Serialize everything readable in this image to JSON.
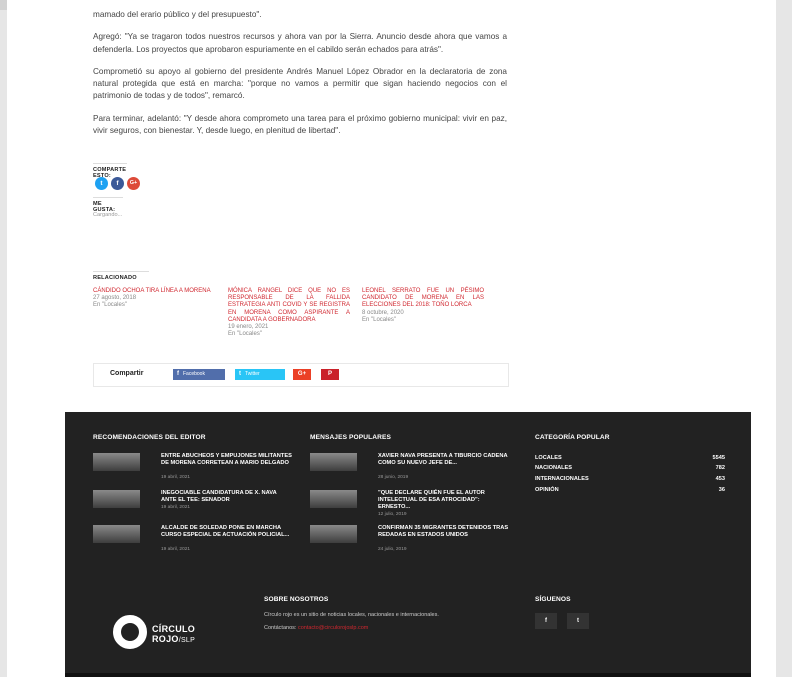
{
  "article": {
    "p0": "mamado del erario público y del presupuesto\".",
    "p1": "Agregó: \"Ya se tragaron todos nuestros recursos y ahora van por la Sierra. Anuncio desde ahora que vamos a defenderla. Los proyectos que aprobaron espuriamente en el cabildo serán echados para atrás\".",
    "p2": "Comprometió su apoyo al gobierno del presidente Andrés Manuel López Obrador en la declaratoria de zona natural protegida que está en marcha: \"porque no vamos a permitir que sigan haciendo negocios con el patrimonio de todas y de todos\", remarcó.",
    "p3": "Para terminar, adelantó: \"Y desde ahora comprometo una tarea para el próximo gobierno municipal: vivir en paz, vivir seguros, con bienestar. Y, desde luego, en plenitud de libertad\"."
  },
  "share": {
    "heading": "COMPARTE ESTO:",
    "twitter_icon": "t",
    "facebook_icon": "f",
    "google_icon": "G+",
    "colors": {
      "twitter": "#1da1f2",
      "facebook": "#3b5998",
      "google": "#dd4b39"
    }
  },
  "likes": {
    "heading": "ME GUSTA:",
    "loading": "Cargando..."
  },
  "related": {
    "heading": "RELACIONADO",
    "items": [
      {
        "title": "CÁNDIDO OCHOA TIRA LÍNEA A MORENA",
        "date": "27 agosto, 2018",
        "cat": "En \"Locales\""
      },
      {
        "title": "MÓNICA RANGEL DICE QUE NO ES RESPONSABLE DE LA FALLIDA ESTRATEGIA ANTI COVID Y SE REGISTRA EN MORENA COMO ASPIRANTE A CANDIDATA A GOBERNADORA",
        "date": "19 enero, 2021",
        "cat": "En \"Locales\""
      },
      {
        "title": "LEONEL SERRATO FUE UN PÉSIMO CANDIDATO DE MORENA EN LAS ELECCIONES DEL 2018: TOÑO LORCA",
        "date": "8 octubre, 2020",
        "cat": "En \"Locales\""
      }
    ]
  },
  "sharebar": {
    "label": "Compartir",
    "facebook": "Facebook",
    "twitter": "Twitter",
    "google": "G+",
    "pinterest": "P",
    "facebook_icon": "f",
    "twitter_icon": "t"
  },
  "footer": {
    "editor": {
      "heading": "RECOMENDACIONES DEL EDITOR",
      "posts": [
        {
          "title": "ENTRE ABUCHEOS Y EMPUJONES MILITANTES DE MORENA CORRETEAN A MARIO DELGADO",
          "date": "19 abril, 2021"
        },
        {
          "title": "INEGOCIABLE CANDIDATURA DE X. NAVA ANTE EL TEE: SENADOR",
          "date": "19 abril, 2021"
        },
        {
          "title": "ALCALDE DE SOLEDAD PONE EN MARCHA CURSO ESPECIAL DE ACTUACIÓN POLICIAL...",
          "date": "19 abril, 2021"
        }
      ]
    },
    "popular": {
      "heading": "MENSAJES POPULARES",
      "posts": [
        {
          "title": "XAVIER NAVA PRESENTA A TIBURCIO CADENA COMO SU NUEVO JEFE DE...",
          "date": "28 junio, 2019"
        },
        {
          "title": "\"QUE DECLARE QUIÉN FUE EL AUTOR INTELECTUAL DE ESA ATROCIDAD\": ERNESTO...",
          "date": "12 julio, 2019"
        },
        {
          "title": "CONFIRMAN 35 MIGRANTES DETENIDOS TRAS REDADAS EN ESTADOS UNIDOS",
          "date": "24 julio, 2019"
        }
      ]
    },
    "categories": {
      "heading": "CATEGORÍA POPULAR",
      "items": [
        {
          "name": "LOCALES",
          "count": "5545"
        },
        {
          "name": "NACIONALES",
          "count": "782"
        },
        {
          "name": "INTERNACIONALES",
          "count": "453"
        },
        {
          "name": "OPINIÓN",
          "count": "36"
        }
      ]
    },
    "about": {
      "heading": "SOBRE NOSOTROS",
      "text": "Círculo rojo es un sitio de noticias locales, nacionales e internacionales.",
      "contact_label": "Contáctanos:",
      "contact_email": "contacto@circulorojoslp.com"
    },
    "logo": {
      "line1": "CÍRCULO",
      "line2": "ROJO",
      "suffix": "/SLP"
    },
    "follow": {
      "heading": "SÍGUENOS",
      "facebook_icon": "f",
      "twitter_icon": "t"
    }
  }
}
